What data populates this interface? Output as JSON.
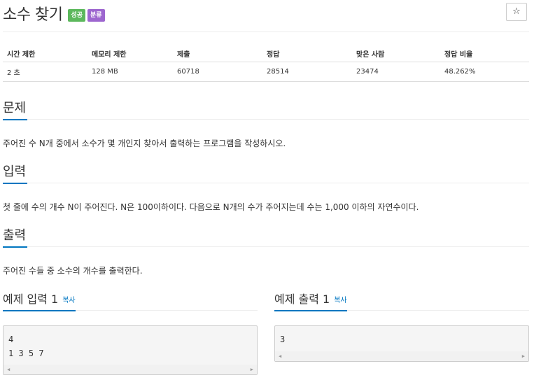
{
  "problem": {
    "title": "소수 찾기",
    "badges": {
      "success": "성공",
      "classified": "분류"
    },
    "star_icon": "☆"
  },
  "info_table": {
    "headers": [
      "시간 제한",
      "메모리 제한",
      "제출",
      "정답",
      "맞은 사람",
      "정답 비율"
    ],
    "row": [
      "2 초",
      "128 MB",
      "60718",
      "28514",
      "23474",
      "48.262%"
    ]
  },
  "sections": {
    "description": {
      "heading": "문제",
      "text": "주어진 수 N개 중에서 소수가 몇 개인지 찾아서 출력하는 프로그램을 작성하시오."
    },
    "input": {
      "heading": "입력",
      "text": "첫 줄에 수의 개수 N이 주어진다. N은 100이하이다. 다음으로 N개의 수가 주어지는데 수는 1,000 이하의 자연수이다."
    },
    "output": {
      "heading": "출력",
      "text": "주어진 수들 중 소수의 개수를 출력한다."
    }
  },
  "samples": {
    "input": {
      "heading": "예제 입력 1",
      "copy_label": "복사",
      "content": "4\n1 3 5 7"
    },
    "output": {
      "heading": "예제 출력 1",
      "copy_label": "복사",
      "content": "3"
    }
  },
  "colors": {
    "success": "#5cb85c",
    "classified": "#9d66cf",
    "accent": "#0076c0"
  }
}
